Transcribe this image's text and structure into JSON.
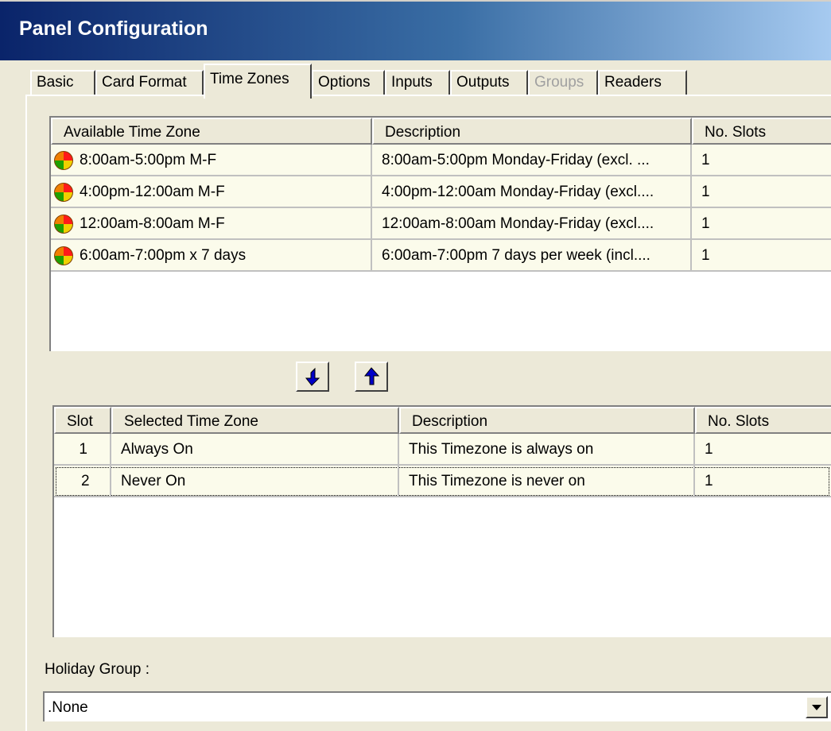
{
  "window": {
    "title": "Panel Configuration"
  },
  "tabs": [
    {
      "label": "Basic"
    },
    {
      "label": "Card Format"
    },
    {
      "label": "Time Zones",
      "active": true
    },
    {
      "label": "Options"
    },
    {
      "label": "Inputs"
    },
    {
      "label": "Outputs"
    },
    {
      "label": "Groups",
      "disabled": true
    },
    {
      "label": "Readers"
    }
  ],
  "available": {
    "columns": [
      "Available Time Zone",
      "Description",
      "No. Slots"
    ],
    "rows": [
      {
        "name": "8:00am-5:00pm M-F",
        "description": "8:00am-5:00pm Monday-Friday (excl. ...",
        "slots": "1",
        "icon": "time-zone-clock-icon"
      },
      {
        "name": "4:00pm-12:00am M-F",
        "description": "4:00pm-12:00am Monday-Friday (excl....",
        "slots": "1",
        "icon": "time-zone-clock-icon"
      },
      {
        "name": "12:00am-8:00am M-F",
        "description": "12:00am-8:00am Monday-Friday (excl....",
        "slots": "1",
        "icon": "time-zone-clock-icon"
      },
      {
        "name": "6:00am-7:00pm x 7 days",
        "description": "6:00am-7:00pm 7 days per week (incl....",
        "slots": "1",
        "icon": "time-zone-clock-icon"
      }
    ]
  },
  "buttons": {
    "add_icon": "arrow-down-icon",
    "remove_icon": "arrow-up-icon"
  },
  "selected": {
    "columns": [
      "Slot",
      "Selected Time Zone",
      "Description",
      "No. Slots"
    ],
    "rows": [
      {
        "slot": "1",
        "name": "Always On",
        "description": "This Timezone is always on",
        "slots": "1"
      },
      {
        "slot": "2",
        "name": "Never On",
        "description": "This Timezone is never on",
        "slots": "1"
      }
    ]
  },
  "holiday": {
    "label": "Holiday Group :",
    "value": ".None"
  },
  "colors": {
    "row_bg": "#fbfbeb",
    "title_bar": "#0a246a",
    "arrow_blue": "#0000c8"
  }
}
